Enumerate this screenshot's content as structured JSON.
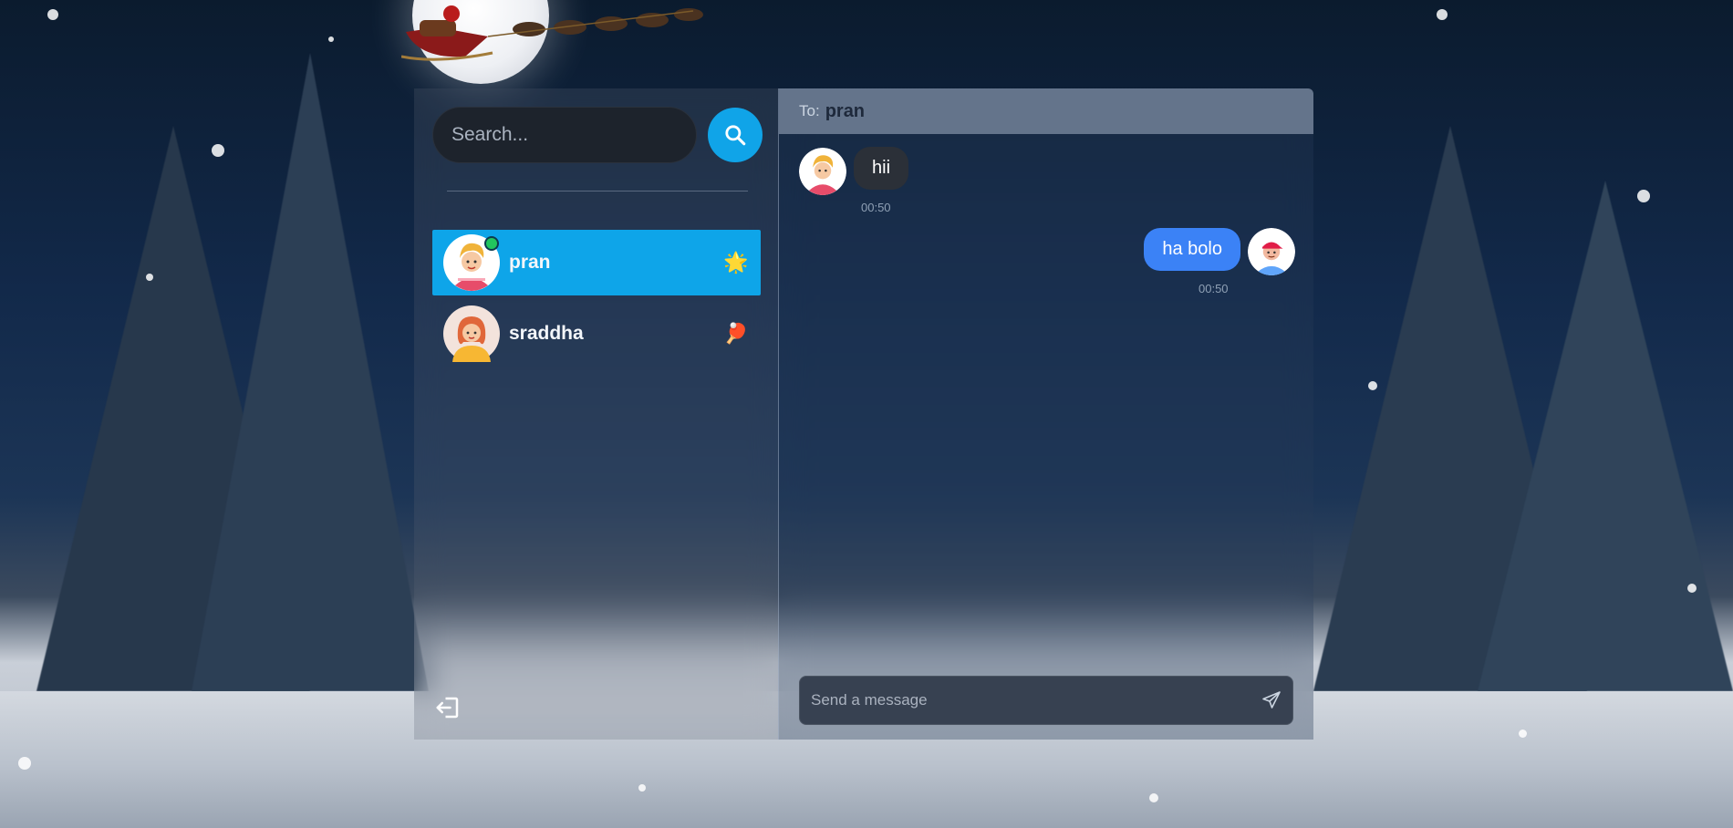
{
  "search": {
    "placeholder": "Search..."
  },
  "conversations": [
    {
      "name": "pran",
      "emoji": "🌟",
      "active": true,
      "online": true
    },
    {
      "name": "sraddha",
      "emoji": "🏓",
      "active": false,
      "online": false
    }
  ],
  "chat": {
    "to_label": "To:",
    "recipient": "pran",
    "messages": [
      {
        "text": "hii",
        "time": "00:50",
        "direction": "in"
      },
      {
        "text": "ha bolo",
        "time": "00:50",
        "direction": "out"
      }
    ],
    "composer_placeholder": "Send a message"
  },
  "colors": {
    "accent": "#0ea5e9",
    "outgoing_bubble": "#3b82f6",
    "incoming_bubble": "#2b3038",
    "header": "#64748b"
  },
  "icons": {
    "search": "search-icon",
    "logout": "logout-icon",
    "send": "send-icon"
  }
}
